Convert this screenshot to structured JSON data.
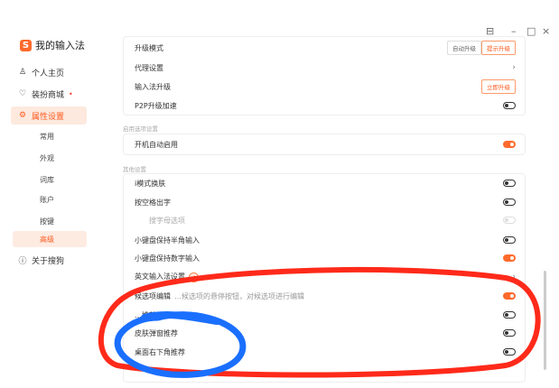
{
  "app": {
    "title": "我的输入法",
    "logo_glyph": "S"
  },
  "window_controls": {
    "feedback": "⊟",
    "minimize": "–",
    "maximize": "□",
    "close": "×"
  },
  "sidebar": {
    "items": [
      {
        "label": "个人主页",
        "icon": "person-icon"
      },
      {
        "label": "装扮商城",
        "icon": "shirt-icon",
        "badge": "•"
      },
      {
        "label": "属性设置",
        "icon": "gear-icon"
      },
      {
        "label": "关于搜狗",
        "icon": "info-icon"
      }
    ],
    "sub_items": [
      "常用",
      "外观",
      "词库",
      "账户",
      "按键",
      "高级"
    ],
    "active_sub": "高级"
  },
  "upgrade_card": {
    "rows": [
      {
        "label": "升级模式",
        "buttons": [
          "自动升级",
          "提示升级"
        ]
      },
      {
        "label": "代理设置"
      },
      {
        "label": "输入法升级",
        "button": "立即升级"
      },
      {
        "label": "P2P升级加速"
      }
    ]
  },
  "startup_section": {
    "label": "启用选项设置",
    "rows": [
      {
        "label": "开机自动启用"
      }
    ]
  },
  "other_section": {
    "label": "其他设置",
    "rows": [
      {
        "label": "i模式换肤"
      },
      {
        "label": "按空格出字"
      },
      {
        "label": "搜字母选项"
      },
      {
        "label": "小键盘保持半角输入"
      },
      {
        "label": "小键盘保持数字输入"
      },
      {
        "label": "英文输入法设置"
      },
      {
        "label": "候选项编辑",
        "note": "…候选项的悬停按钮，对候选项进行编辑"
      },
      {
        "label": "…推荐"
      },
      {
        "label": "皮肤弹窗推荐"
      },
      {
        "label": "桌面右下角推荐"
      }
    ]
  },
  "colors": {
    "accent": "#ff6a2d",
    "red_annotation": "#ff2a1a",
    "blue_annotation": "#1a6fff"
  }
}
